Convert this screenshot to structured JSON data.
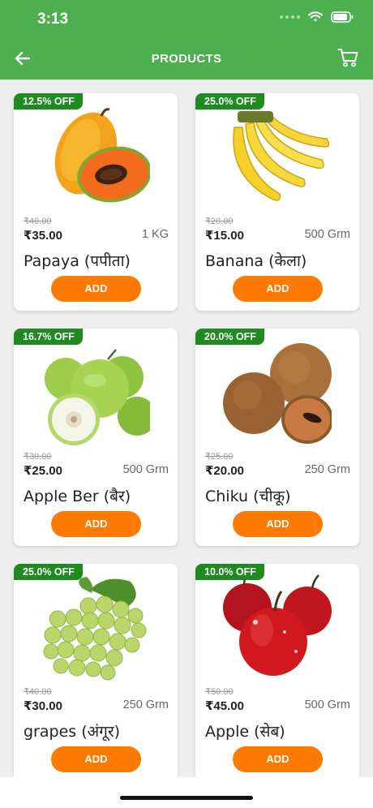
{
  "status": {
    "time": "3:13"
  },
  "nav": {
    "title": "PRODUCTS"
  },
  "colors": {
    "header": "#4caf50",
    "badge": "#1f8a1f",
    "add_button": "#ff7a00"
  },
  "products": [
    {
      "discount": "12.5% OFF",
      "mrp": "₹40.00",
      "price": "₹35.00",
      "qty": "1 KG",
      "name": "Papaya (पपीता)",
      "add": "ADD",
      "image": "papaya"
    },
    {
      "discount": "25.0% OFF",
      "mrp": "₹20.00",
      "price": "₹15.00",
      "qty": "500 Grm",
      "name": "Banana (केला)",
      "add": "ADD",
      "image": "banana"
    },
    {
      "discount": "16.7% OFF",
      "mrp": "₹30.00",
      "price": "₹25.00",
      "qty": "500 Grm",
      "name": "Apple Ber (बैर)",
      "add": "ADD",
      "image": "apple-ber"
    },
    {
      "discount": "20.0% OFF",
      "mrp": "₹25.00",
      "price": "₹20.00",
      "qty": "250 Grm",
      "name": "Chiku (चीकू)",
      "add": "ADD",
      "image": "chiku"
    },
    {
      "discount": "25.0% OFF",
      "mrp": "₹40.00",
      "price": "₹30.00",
      "qty": "250 Grm",
      "name": "grapes (अंगूर)",
      "add": "ADD",
      "image": "grapes"
    },
    {
      "discount": "10.0% OFF",
      "mrp": "₹50.00",
      "price": "₹45.00",
      "qty": "500 Grm",
      "name": "Apple (सेब)",
      "add": "ADD",
      "image": "apple"
    }
  ]
}
